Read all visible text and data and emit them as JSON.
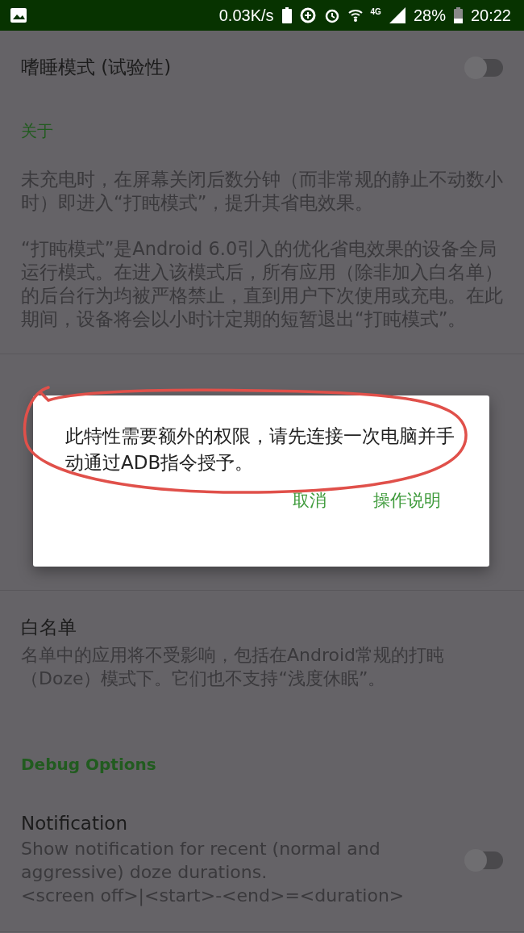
{
  "status_bar": {
    "speed": "0.03K/s",
    "network": "4G",
    "battery": "28%",
    "time": "20:22"
  },
  "settings": [
    {
      "kind": "switch",
      "title": "嗜睡模式 (试验性)",
      "on": false
    },
    {
      "kind": "header",
      "title": "关于"
    },
    {
      "kind": "text",
      "paragraphs": [
        "未充电时，在屏幕关闭后数分钟（而非常规的静止不动数小时）即进入“打盹模式”，提升其省电效果。",
        "“打盹模式”是Android 6.0引入的优化省电效果的设备全局运行模式。在进入该模式后，所有应用（除非加入白名单）的后台行为均被严格禁止，直到用户下次使用或充电。在此期间，设备将会以小时计定期的短暂退出“打盹模式”。"
      ]
    },
    {
      "kind": "hidden"
    },
    {
      "kind": "item",
      "title": "白名单",
      "summary": "名单中的应用将不受影响，包括在Android常规的打盹（Doze）模式下。它们也不支持“浅度休眠”。"
    },
    {
      "kind": "header",
      "title": "Debug Options"
    },
    {
      "kind": "switch",
      "title": "Notification",
      "summary": "Show notification for recent (normal and aggressive) doze durations.\n<screen off>|<start>-<end>=<duration>",
      "on": false
    }
  ],
  "dialog": {
    "message": "此特性需要额外的权限，请先连接一次电脑并手动通过ADB指令授予。",
    "buttons": [
      "取消",
      "操作说明"
    ]
  }
}
